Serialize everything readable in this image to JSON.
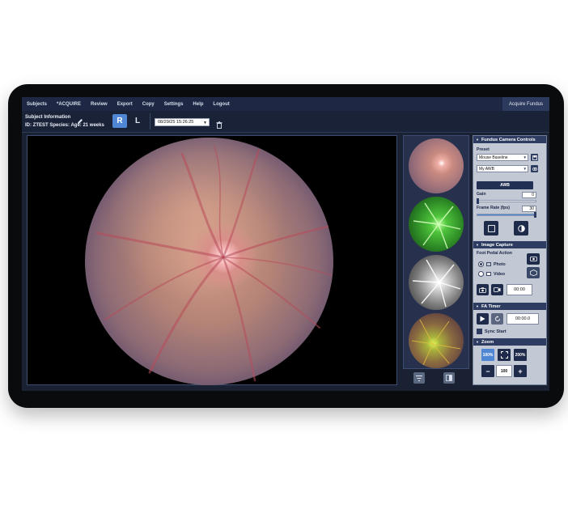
{
  "menu": {
    "items": [
      "Subjects",
      "*ACQUIRE",
      "Review",
      "Export",
      "Copy",
      "Settings",
      "Help",
      "Logout"
    ],
    "right_label": "Acquire Fundus"
  },
  "subject": {
    "title": "Subject Information",
    "line": "ID: ZTEST  Species:   Age: 21 weeks",
    "eye_right": "R",
    "eye_left": "L",
    "datetime": "08/29/25 15:26:25"
  },
  "panel": {
    "camera": {
      "header": "Fundus Camera Controls",
      "preset_label": "Preset",
      "preset_value": "Mouse Baseline",
      "awb_select": "My AWB",
      "awb_button": "AWB",
      "gain_label": "Gain",
      "gain_value": "0",
      "gain_level": 0.02,
      "framerate_label": "Frame Rate (fps)",
      "framerate_value": "30",
      "framerate_level": 1.0
    },
    "capture": {
      "header": "Image Capture",
      "foot_pedal_label": "Foot Pedal Action",
      "photo_label": "Photo",
      "video_label": "Video",
      "timer_value": "00:00"
    },
    "fa_timer": {
      "header": "FA Timer",
      "value": "00:00.0",
      "sync_label": "Sync Start"
    },
    "zoom": {
      "header": "Zoom",
      "fit_label": "100%",
      "double_label": "200%",
      "value": "100",
      "minus": "−",
      "plus": "+"
    }
  },
  "colors": {
    "accent": "#4f87d4",
    "menubar": "#1e2844",
    "panel_bg": "#c2c9d5",
    "section_header": "#2d3c60"
  }
}
